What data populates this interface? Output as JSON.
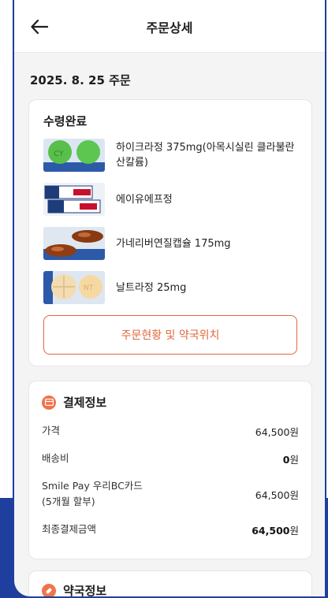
{
  "header": {
    "title": "주문상세",
    "back_icon": "arrow-left-icon"
  },
  "order_date": "2025. 8. 25 주문",
  "status": {
    "label": "수령완료",
    "items": [
      {
        "name": "하이크라정 375mg(아목시실린 클라불란산칼륨)",
        "image": "green-round-tablet"
      },
      {
        "name": "에이유에프정",
        "image": "medicine-box"
      },
      {
        "name": "가네리버연질캡슐 175mg",
        "image": "brown-softgel-capsule"
      },
      {
        "name": "날트라정 25mg",
        "image": "beige-round-tablet"
      }
    ],
    "button_label": "주문현황 및 약국위치"
  },
  "payment": {
    "title": "결제정보",
    "icon": "card-icon",
    "rows": [
      {
        "label": "가격",
        "value": "64,500원"
      },
      {
        "label": "배송비",
        "value_num": "0",
        "value_unit": "원"
      },
      {
        "label_line1": "Smile Pay 우리BC카드",
        "label_line2": "(5개월 할부)",
        "value": "64,500원"
      },
      {
        "label": "최종결제금액",
        "value_num": "64,500",
        "value_unit": "원"
      }
    ]
  },
  "pharmacy": {
    "title": "약국정보",
    "icon": "pill-icon"
  },
  "colors": {
    "accent": "#e0683a",
    "frame": "#1f3f9e",
    "background": "#f4f4f5"
  }
}
